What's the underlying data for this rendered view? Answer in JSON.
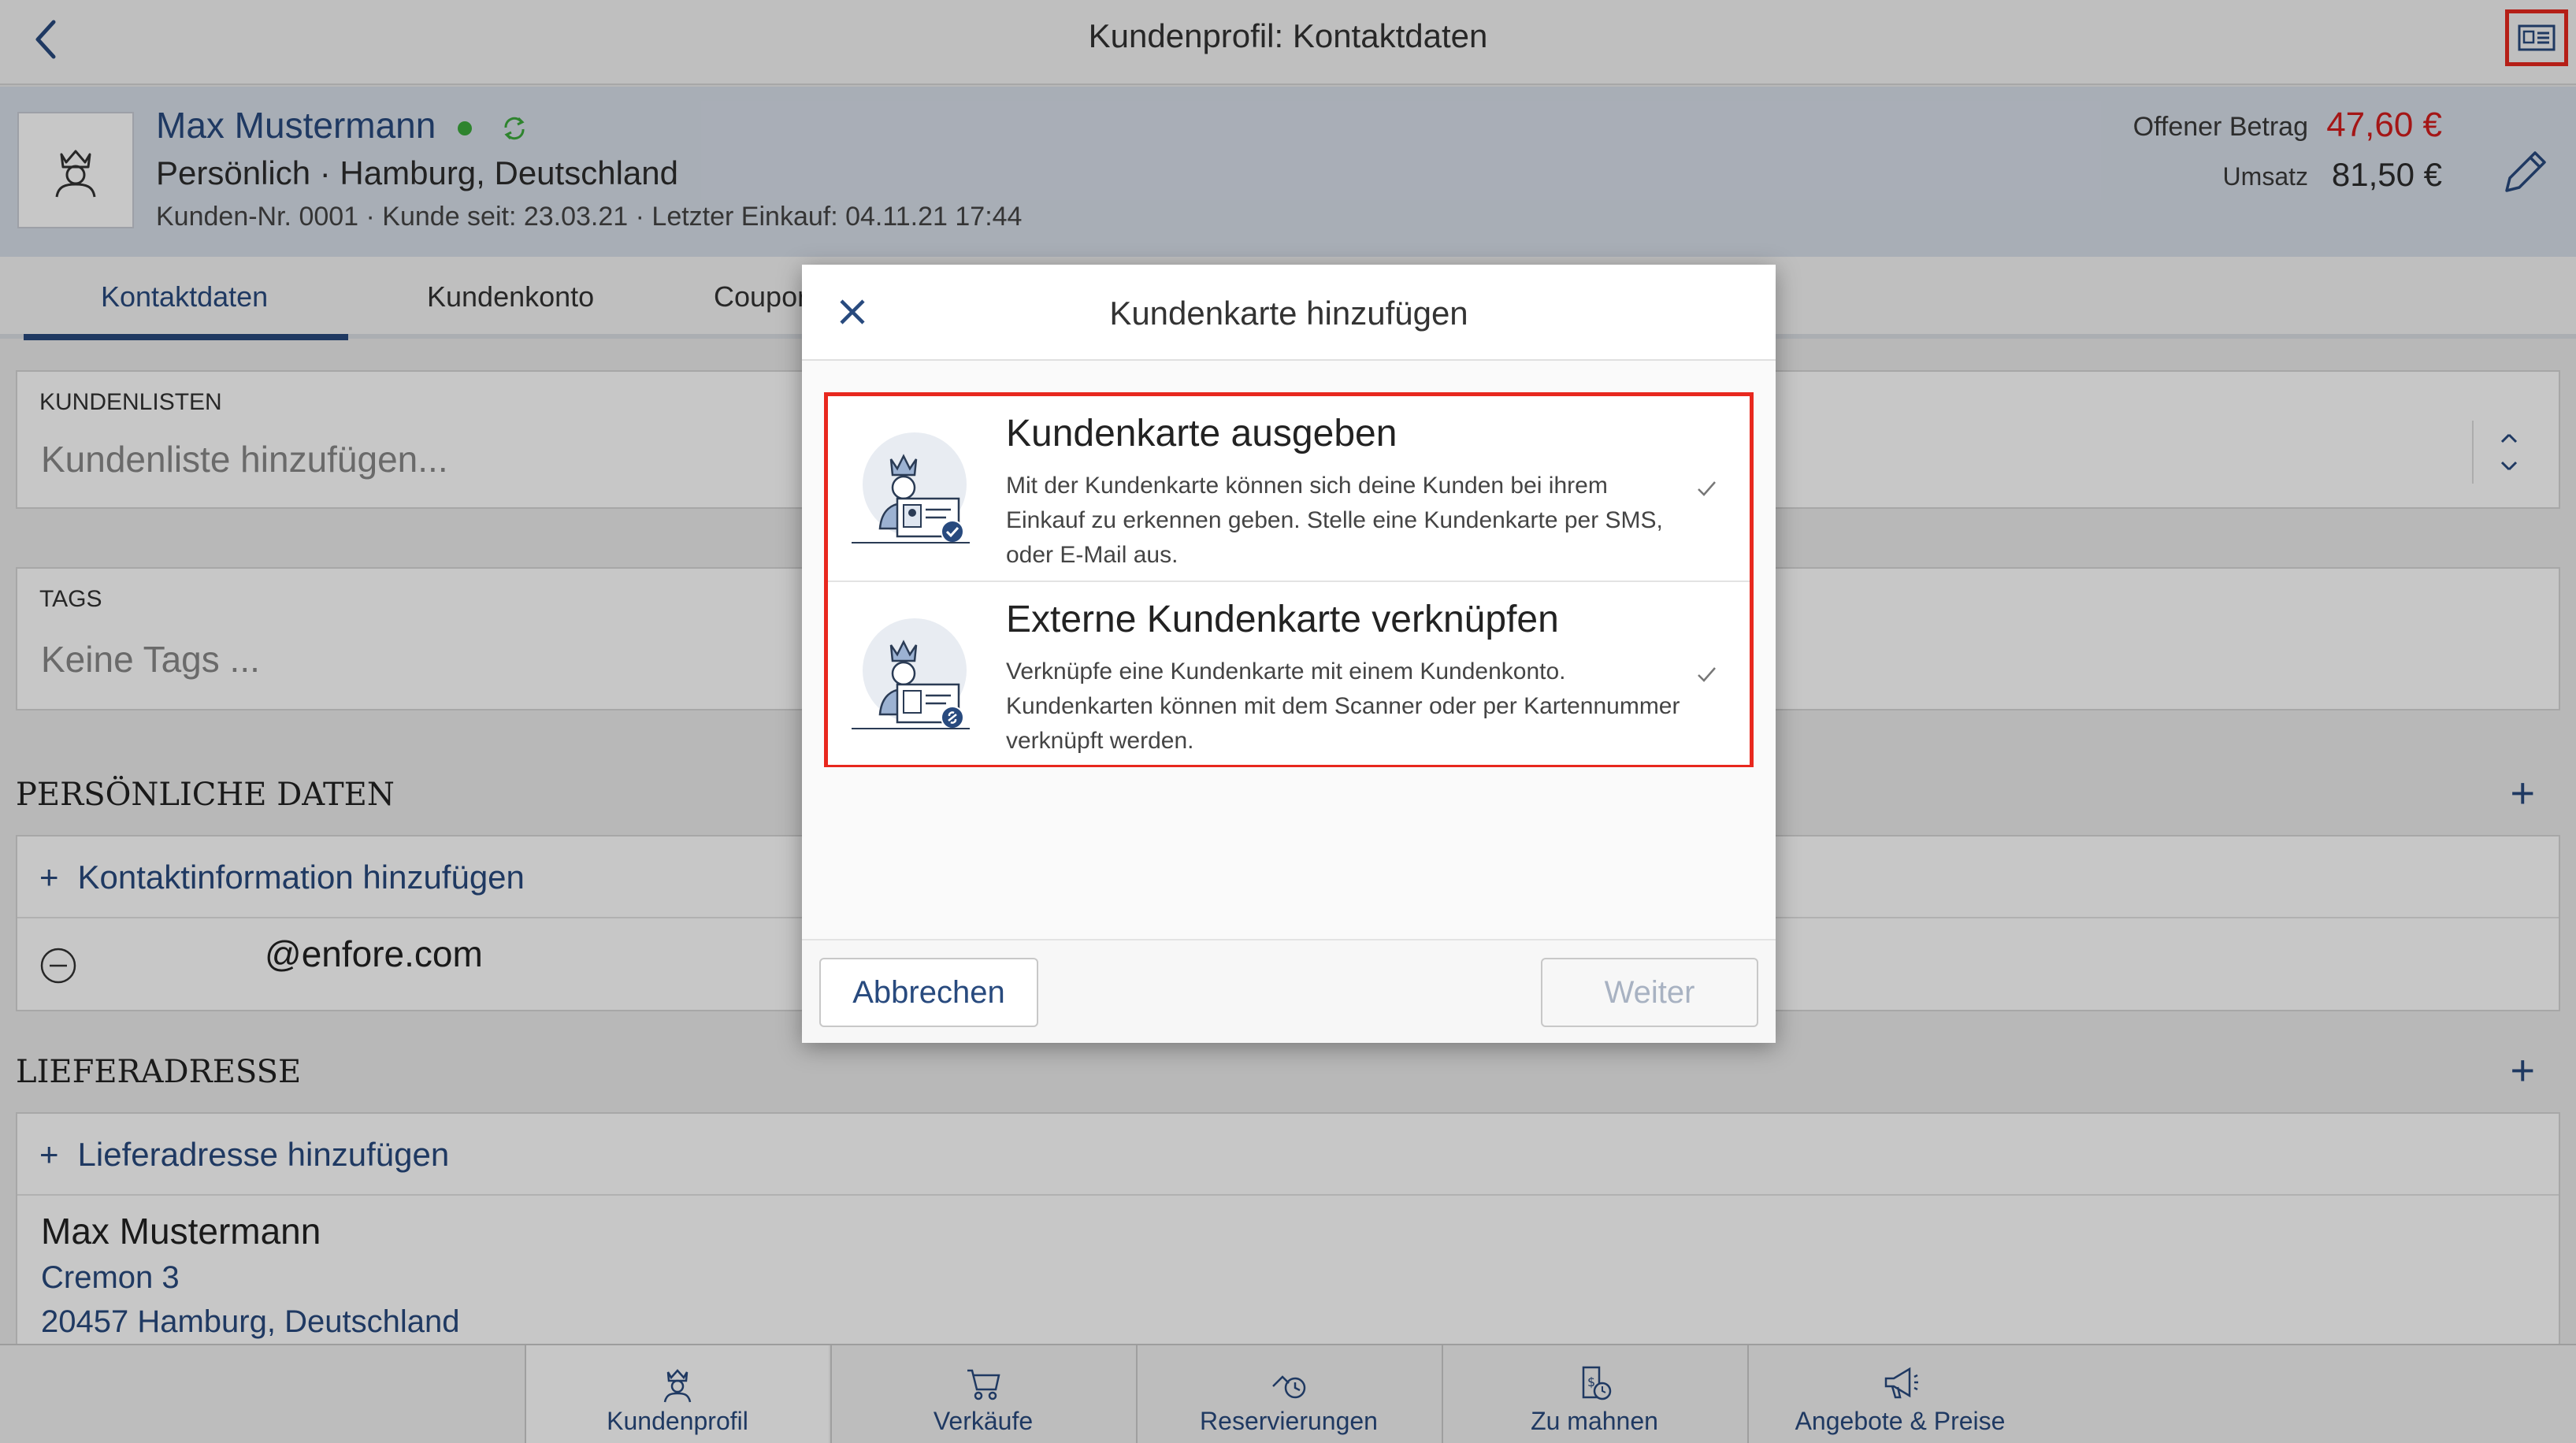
{
  "topbar": {
    "title": "Kundenprofil: Kontaktdaten"
  },
  "customer": {
    "name": "Max Mustermann",
    "subtitle": "Persönlich · Hamburg, Deutschland",
    "meta": "Kunden-Nr. 0001 · Kunde seit: 23.03.21 · Letzter Einkauf: 04.11.21 17:44",
    "open_label": "Offener Betrag",
    "open_value": "47,60 €",
    "revenue_label": "Umsatz",
    "revenue_value": "81,50 €"
  },
  "tabs": [
    "Kontaktdaten",
    "Kundenkonto",
    "Coupor"
  ],
  "kundenlisten": {
    "label": "KUNDENLISTEN",
    "placeholder": "Kundenliste hinzufügen..."
  },
  "tags": {
    "label": "TAGS",
    "placeholder": "Keine Tags ..."
  },
  "personal": {
    "title": "PERSÖNLICHE DATEN",
    "add_contact": "Kontaktinformation hinzufügen",
    "email": "@enfore.com"
  },
  "delivery": {
    "title": "LIEFERADRESSE",
    "add": "Lieferadresse hinzufügen",
    "name": "Max Mustermann",
    "street": "Cremon 3",
    "city": "20457 Hamburg, Deutschland"
  },
  "tabbar": [
    "Kundenprofil",
    "Verkäufe",
    "Reservierungen",
    "Zu mahnen",
    "Angebote & Preise"
  ],
  "modal": {
    "title": "Kundenkarte hinzufügen",
    "options": [
      {
        "title": "Kundenkarte ausgeben",
        "desc": "Mit der Kundenkarte können sich deine Kunden bei ihrem Einkauf zu erkennen geben. Stelle eine Kundenkarte per SMS, oder E-Mail aus."
      },
      {
        "title": "Externe Kundenkarte verknüpfen",
        "desc": "Verknüpfe eine Kundenkarte mit einem Kundenkonto. Kundenkarten können mit dem Scanner oder per Kartennummer verknüpft werden."
      }
    ],
    "cancel": "Abbrechen",
    "next": "Weiter"
  },
  "colors": {
    "accent": "#284a7e",
    "highlight": "#e8281e",
    "open_amount": "#d21d1d",
    "status": "#3caa3c"
  }
}
